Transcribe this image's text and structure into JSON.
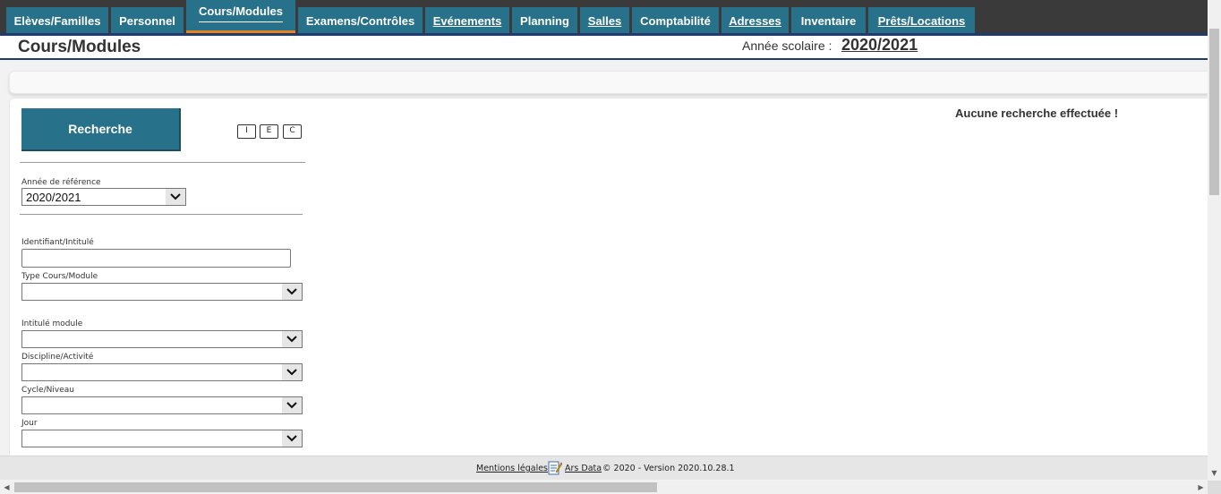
{
  "nav": {
    "tabs": [
      {
        "label": "Elèves/Familles"
      },
      {
        "label": "Personnel"
      },
      {
        "label": "Cours/Modules"
      },
      {
        "label": "Examens/Contrôles"
      },
      {
        "label": "Evénements"
      },
      {
        "label": "Planning"
      },
      {
        "label": "Salles"
      },
      {
        "label": "Comptabilité"
      },
      {
        "label": "Adresses"
      },
      {
        "label": "Inventaire"
      },
      {
        "label": "Prêts/Locations"
      }
    ],
    "active_tab": "Cours/Modules"
  },
  "header": {
    "title": "Cours/Modules",
    "school_year_label": "Année scolaire :",
    "school_year_value": "2020/2021"
  },
  "search_panel": {
    "search_button": "Recherche",
    "mini_buttons": [
      "I",
      "E",
      "C"
    ],
    "no_search_message": "Aucune recherche effectuée !",
    "reference_year": {
      "label": "Année de référence",
      "value": "2020/2021"
    },
    "identifier": {
      "label": "Identifiant/Intitulé",
      "value": ""
    },
    "course_type": {
      "label": "Type Cours/Module",
      "value": ""
    },
    "module_title": {
      "label": "Intitulé module",
      "value": ""
    },
    "discipline": {
      "label": "Discipline/Activité",
      "value": ""
    },
    "cycle": {
      "label": "Cycle/Niveau",
      "value": ""
    },
    "day": {
      "label": "Jour",
      "value": ""
    }
  },
  "footer": {
    "legal_link": "Mentions légales",
    "brand_link": "Ars Data",
    "copyright": "© 2020 - Version 2020.10.28.1"
  },
  "colors": {
    "tab_bg": "#27718a",
    "nav_bg": "#3a3a3a",
    "active_underline": "#e8821f",
    "header_rule": "#1f3c6b"
  }
}
